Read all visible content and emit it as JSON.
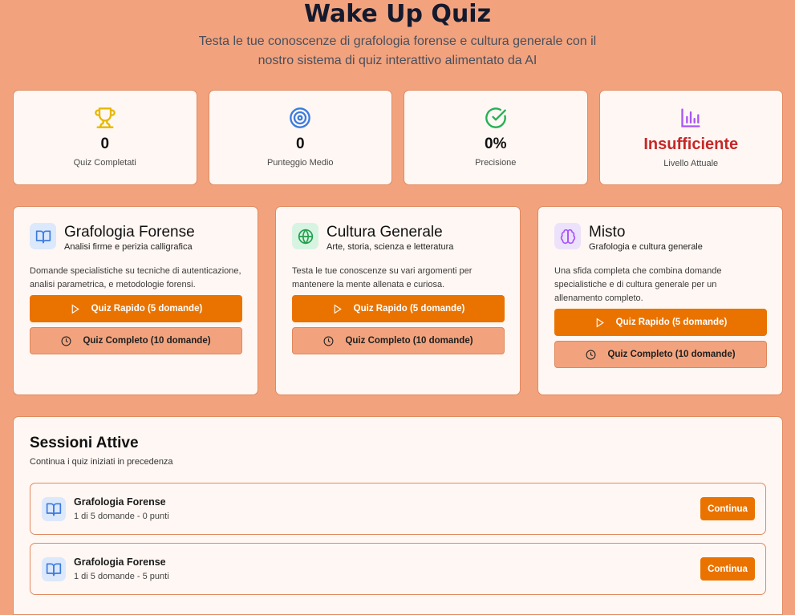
{
  "header": {
    "title": "Wake Up Quiz",
    "subtitle": "Testa le tue conoscenze di grafologia forense e cultura generale con il nostro sistema di quiz interattivo alimentato da AI"
  },
  "stats": [
    {
      "icon": "trophy-icon",
      "value": "0",
      "label": "Quiz Completati",
      "color": "#e6b800"
    },
    {
      "icon": "target-icon",
      "value": "0",
      "label": "Punteggio Medio",
      "color": "#3b7be0"
    },
    {
      "icon": "check-circle-icon",
      "value": "0%",
      "label": "Precisione",
      "color": "#22b055"
    },
    {
      "icon": "bar-chart-icon",
      "value": "Insufficiente",
      "label": "Livello Attuale",
      "color": "#a855f7"
    }
  ],
  "categories": [
    {
      "title": "Grafologia Forense",
      "subtitle": "Analisi firme e perizia calligrafica",
      "description": "Domande specialistiche su tecniche di autenticazione, analisi parametrica, e metodologie forensi.",
      "quick": "Quiz Rapido (5 domande)",
      "full": "Quiz Completo (10 domande)"
    },
    {
      "title": "Cultura Generale",
      "subtitle": "Arte, storia, scienza e letteratura",
      "description": "Testa le tue conoscenze su vari argomenti per mantenere la mente allenata e curiosa.",
      "quick": "Quiz Rapido (5 domande)",
      "full": "Quiz Completo (10 domande)"
    },
    {
      "title": "Misto",
      "subtitle": "Grafologia e cultura generale",
      "description": "Una sfida completa che combina domande specialistiche e di cultura generale per un allenamento completo.",
      "quick": "Quiz Rapido (5 domande)",
      "full": "Quiz Completo (10 domande)"
    }
  ],
  "sessions": {
    "title": "Sessioni Attive",
    "subtitle": "Continua i quiz iniziati in precedenza",
    "items": [
      {
        "name": "Grafologia Forense",
        "meta": "1 di 5 domande - 0 punti",
        "action": "Continua"
      },
      {
        "name": "Grafologia Forense",
        "meta": "1 di 5 domande - 5 punti",
        "action": "Continua"
      }
    ]
  },
  "colors": {
    "background": "#f2a37e",
    "accent": "#ea7300",
    "danger": "#c62828"
  }
}
